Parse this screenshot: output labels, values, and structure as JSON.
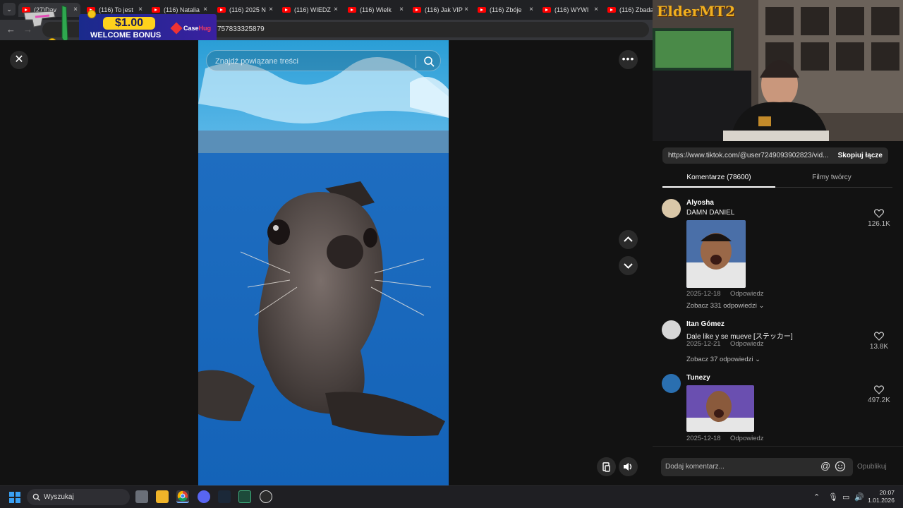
{
  "browser": {
    "tabs": [
      {
        "label": "(27)Dav"
      },
      {
        "label": "(116) To jest"
      },
      {
        "label": "(116) Natalia"
      },
      {
        "label": "(116) 2025 N"
      },
      {
        "label": "(116) WIEDZ"
      },
      {
        "label": "(116) Wielk"
      },
      {
        "label": "(116) Jak VIP"
      },
      {
        "label": "(116) Zbóje"
      },
      {
        "label": "(116) WYWI"
      },
      {
        "label": "(116) Zbada"
      }
    ],
    "url_fragment": "757833325879"
  },
  "ad": {
    "amount": "$1.00",
    "bonus": "WELCOME BONUS",
    "brand": "Case",
    "brand_suffix": "Hug"
  },
  "video_viewer": {
    "search_placeholder": "Znajdź powiązane treści",
    "close_glyph": "✕",
    "more_glyph": "•••"
  },
  "stream_overlay": {
    "logo": "ElderMT2"
  },
  "share": {
    "link": "https://www.tiktok.com/@user7249093902823/vid...",
    "copy_label": "Skopiuj łącze"
  },
  "panel_tabs": {
    "comments": "Komentarze (78600)",
    "creator_videos": "Filmy twórcy"
  },
  "comments": [
    {
      "user": "Alyosha",
      "text": "DAMN DANIEL",
      "date": "2025-12-18",
      "reply": "Odpowiedz",
      "view_replies": "Zobacz 331 odpowiedzi",
      "likes": "126.1K"
    },
    {
      "user": "Itan Gómez",
      "text": "Dale like y se mueve [ステッカー]",
      "date": "2025-12-21",
      "reply": "Odpowiedz",
      "view_replies": "Zobacz 37 odpowiedzi",
      "likes": "13.8K"
    },
    {
      "user": "Tunezy",
      "text": "",
      "date": "2025-12-18",
      "reply": "Odpowiedz",
      "likes": "497.2K"
    }
  ],
  "composer": {
    "placeholder": "Dodaj komentarz...",
    "publish": "Opublikuj"
  },
  "taskbar": {
    "search_label": "Wyszukaj",
    "time": "20:07",
    "date": "1.01.2026"
  },
  "colors": {
    "accent_video_blue": "#1f6fc4",
    "panel_bg": "#121212",
    "youtube_red": "#ff0000"
  }
}
